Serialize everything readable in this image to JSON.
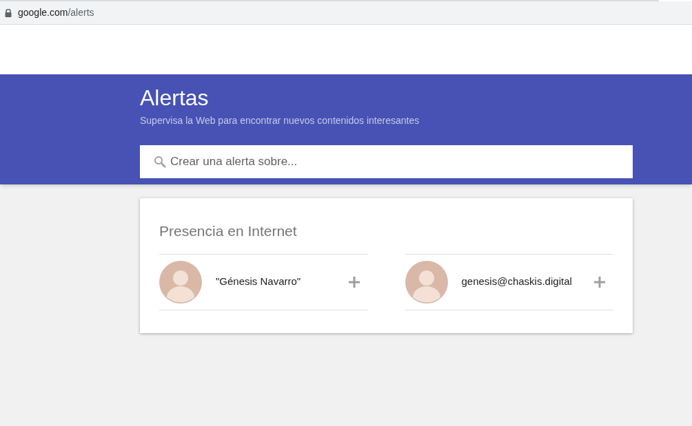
{
  "address_bar": {
    "host": "google.com",
    "path": "/alerts"
  },
  "header": {
    "title": "Alertas",
    "subtitle": "Supervisa la Web para encontrar nuevos contenidos interesantes"
  },
  "search": {
    "placeholder": "Crear una alerta sobre..."
  },
  "card": {
    "title": "Presencia en Internet",
    "suggestions": [
      {
        "label": "\"Génesis Navarro\""
      },
      {
        "label": "genesis@chaskis.digital"
      }
    ]
  }
}
